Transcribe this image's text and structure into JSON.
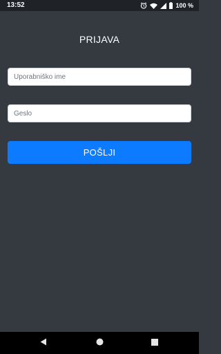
{
  "status_bar": {
    "time": "13:52",
    "battery_percent": "100 %",
    "icons": [
      "alarm-icon",
      "wifi-icon",
      "signal-icon",
      "battery-icon"
    ]
  },
  "login": {
    "title": "PRIJAVA",
    "username_placeholder": "Uporabniško ime",
    "password_placeholder": "Geslo",
    "submit_label": "POŠLJI"
  },
  "nav_bar": {
    "icons": [
      "back-icon",
      "home-icon",
      "recent-apps-icon"
    ]
  },
  "colors": {
    "background": "#353a40",
    "status_bar": "#1f2226",
    "nav_bar": "#000000",
    "accent": "#0d7bff",
    "input_background": "#ffffff"
  }
}
